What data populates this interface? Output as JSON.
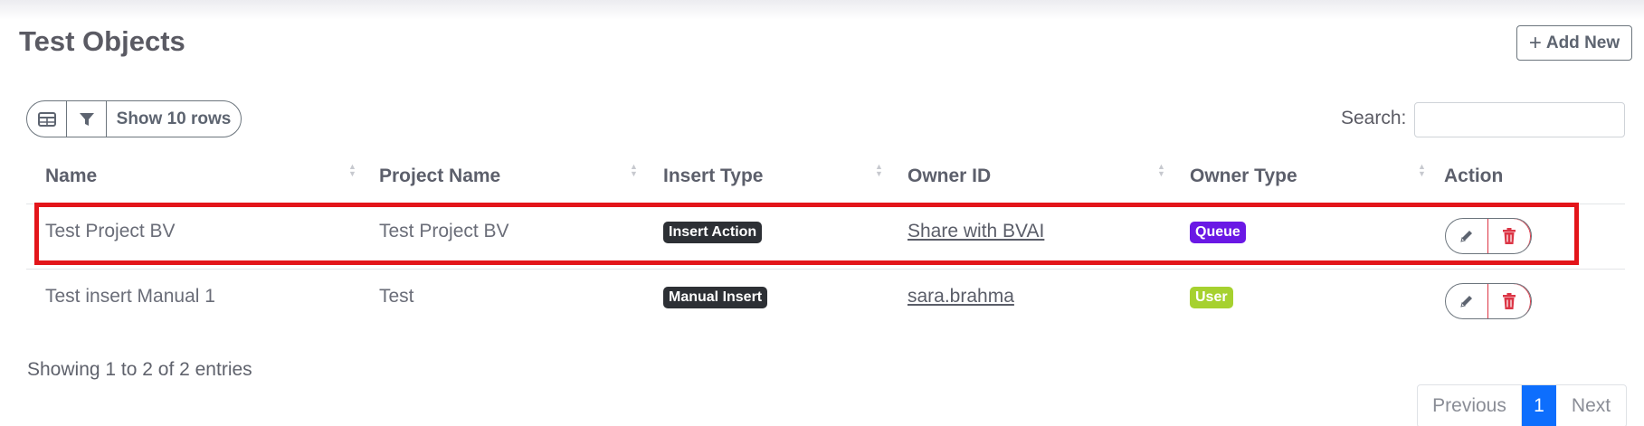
{
  "page": {
    "title": "Test Objects"
  },
  "header": {
    "add_new_label": "Add New"
  },
  "toolbar": {
    "rows_label": "Show 10 rows",
    "search_label": "Search:",
    "search_value": ""
  },
  "table": {
    "columns": [
      "Name",
      "Project Name",
      "Insert Type",
      "Owner ID",
      "Owner Type",
      "Action"
    ],
    "rows": [
      {
        "name": "Test Project BV",
        "project_name": "Test Project BV",
        "insert_type": "Insert Action",
        "owner_id": "Share with BVAI",
        "owner_type": "Queue"
      },
      {
        "name": "Test insert Manual 1",
        "project_name": "Test",
        "insert_type": "Manual Insert",
        "owner_id": "sara.brahma",
        "owner_type": "User"
      }
    ]
  },
  "footer": {
    "info": "Showing 1 to 2 of 2 entries"
  },
  "pagination": {
    "previous": "Previous",
    "current_page": "1",
    "next": "Next"
  },
  "colors": {
    "queue_badge": "#6a18e5",
    "user_badge": "#a6d12f",
    "highlight": "#e3151a",
    "active_page": "#0d6efd"
  }
}
